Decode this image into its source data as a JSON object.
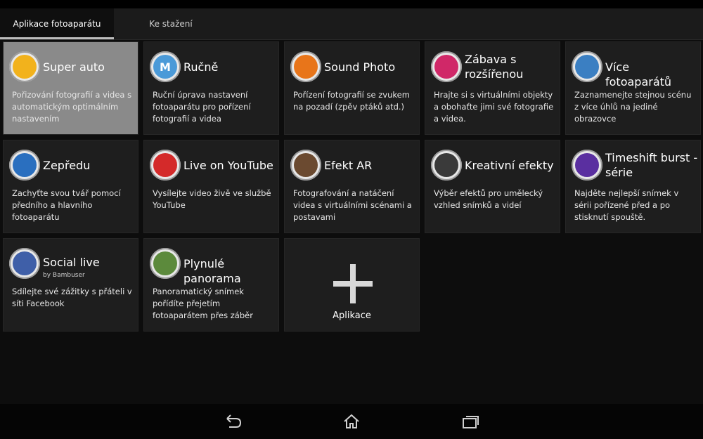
{
  "tabs": [
    {
      "label": "Aplikace fotoaparátu",
      "active": true
    },
    {
      "label": "Ke stažení",
      "active": false
    }
  ],
  "apps": [
    {
      "title": "Super auto",
      "desc": "Pořizování fotografií a videa s automatickým optimálním nastavením",
      "icon": "camera-plus-icon",
      "color": "#f2b21c",
      "selected": true
    },
    {
      "title": "Ručně",
      "desc": "Ruční úprava nastavení fotoaparátu pro pořízení fotografií a videa",
      "icon": "m-letter-icon",
      "color": "#4b9ad8",
      "glyph": "M"
    },
    {
      "title": "Sound Photo",
      "desc": "Pořízení fotografií se zvukem na pozadí (zpěv ptáků atd.)",
      "icon": "sound-photo-icon",
      "color": "#e8751a"
    },
    {
      "title": "Zábava s rozšířenou",
      "desc": "Hrajte si s virtuálními objekty a obohaťte jimi své fotografie a videa.",
      "icon": "colorful-balls-icon",
      "color": "#d02868"
    },
    {
      "title": "Více fotoaparátů",
      "desc": "Zaznamenejte stejnou scénu z více úhlů na jediné obrazovce",
      "icon": "multi-camera-icon",
      "color": "#3b7fc2"
    },
    {
      "title": "Zepředu",
      "desc": "Zachyťte svou tvář pomocí předního a hlavního fotoaparátu",
      "icon": "front-camera-icon",
      "color": "#2a6fbf"
    },
    {
      "title": "Live on YouTube",
      "desc": "Vysílejte video živě ve službě YouTube",
      "icon": "broadcast-icon",
      "color": "#d42a2a"
    },
    {
      "title": "Efekt AR",
      "desc": "Fotografování a natáčení videa s virtuálními scénami a postavami",
      "icon": "dinosaur-icon",
      "color": "#6b4a30"
    },
    {
      "title": "Kreativní efekty",
      "desc": "Výběr efektů pro umělecký vzhled snímků a videí",
      "icon": "palette-icon",
      "color": "#3a3a3a"
    },
    {
      "title": "Timeshift burst - série",
      "desc": "Najděte nejlepší snímek v sérii pořízené před a po stisknutí spouště.",
      "icon": "timer-icon",
      "color": "#5a2fa0"
    },
    {
      "title": "Social live",
      "sub": "by Bambuser",
      "desc": "Sdílejte své zážitky s přáteli v síti Facebook",
      "icon": "social-broadcast-icon",
      "color": "#3f5fa8"
    },
    {
      "title": "Plynulé panorama",
      "desc": "Panoramatický snímek pořídíte přejetím fotoaparátem přes záběr",
      "icon": "panorama-icon",
      "color": "#5c8a3c"
    }
  ],
  "add_tile": {
    "label": "Aplikace",
    "icon": "plus-icon"
  },
  "nav": {
    "back_icon": "back-icon",
    "home_icon": "home-icon",
    "recents_icon": "recents-icon"
  }
}
